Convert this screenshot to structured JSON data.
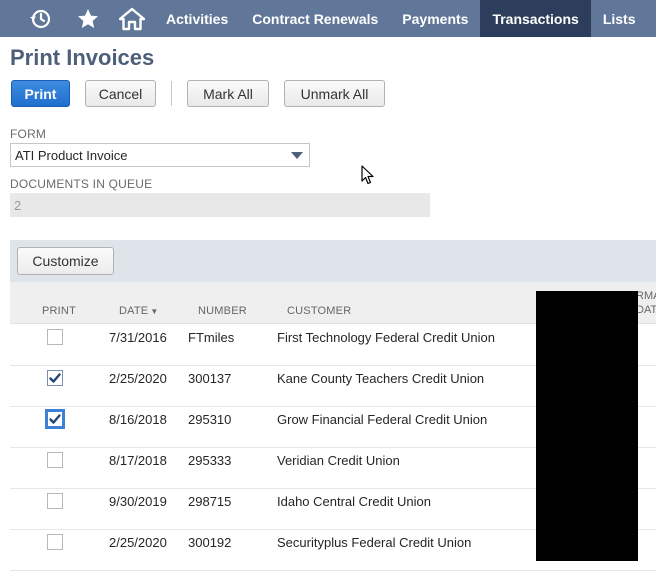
{
  "nav": {
    "icons": [
      "recent-icon",
      "star-icon",
      "home-icon"
    ],
    "tabs": [
      {
        "label": "Activities",
        "active": false
      },
      {
        "label": "Contract Renewals",
        "active": false
      },
      {
        "label": "Payments",
        "active": false
      },
      {
        "label": "Transactions",
        "active": true
      },
      {
        "label": "Lists",
        "active": false
      }
    ],
    "color": "#607799",
    "active_color": "#2d3e5c"
  },
  "page": {
    "title": "Print Invoices"
  },
  "buttons": {
    "print": "Print",
    "cancel": "Cancel",
    "mark_all": "Mark All",
    "unmark_all": "Unmark All",
    "customize": "Customize"
  },
  "form": {
    "label": "FORM",
    "value": "ATI Product Invoice"
  },
  "queue": {
    "label": "DOCUMENTS IN QUEUE",
    "value": "2"
  },
  "table": {
    "headers": {
      "print": "PRINT",
      "date": "DATE",
      "number": "NUMBER",
      "customer": "CUSTOMER",
      "partial_line1": "RMA",
      "partial_line2": "DATE"
    },
    "rows": [
      {
        "checked": false,
        "focused": false,
        "date": "7/31/2016",
        "number": "FTmiles",
        "customer": "First Technology Federal Credit Union"
      },
      {
        "checked": true,
        "focused": false,
        "date": "2/25/2020",
        "number": "300137",
        "customer": "Kane County Teachers Credit Union"
      },
      {
        "checked": true,
        "focused": true,
        "date": "8/16/2018",
        "number": "295310",
        "customer": "Grow Financial Federal Credit Union"
      },
      {
        "checked": false,
        "focused": false,
        "date": "8/17/2018",
        "number": "295333",
        "customer": "Veridian Credit Union"
      },
      {
        "checked": false,
        "focused": false,
        "date": "9/30/2019",
        "number": "298715",
        "customer": "Idaho Central Credit Union"
      },
      {
        "checked": false,
        "focused": false,
        "date": "2/25/2020",
        "number": "300192",
        "customer": "Securityplus Federal Credit Union"
      }
    ]
  },
  "colors": {
    "title": "#4d5f79",
    "primary_button": "#1f6fcf",
    "sublist_bar": "#dfe4eb"
  }
}
